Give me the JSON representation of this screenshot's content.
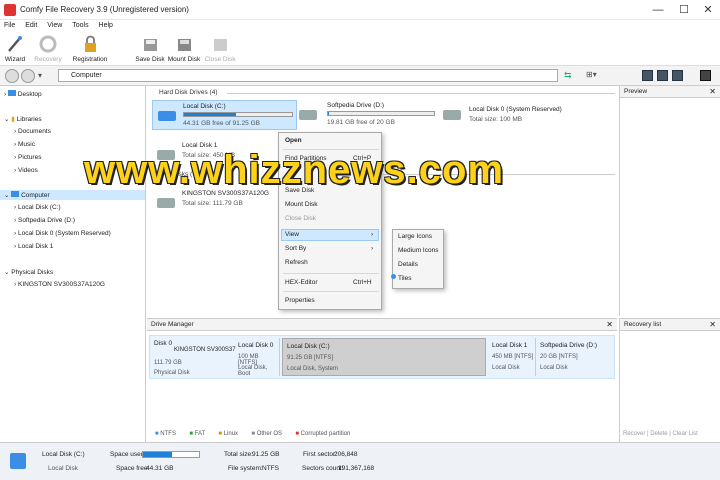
{
  "window": {
    "title": "Comfy File Recovery 3.9 (Unregistered version)",
    "min": "—",
    "max": "☐",
    "close": "✕"
  },
  "menu": [
    "File",
    "Edit",
    "View",
    "Tools",
    "Help"
  ],
  "toolbar": [
    "Wizard",
    "Recovery",
    "Registration",
    "Save Disk",
    "Mount Disk",
    "Close Disk"
  ],
  "address": {
    "path": "Computer"
  },
  "tree": {
    "desktop": "Desktop",
    "libraries": "Libraries",
    "documents": "Documents",
    "music": "Music",
    "pictures": "Pictures",
    "videos": "Videos",
    "computer": "Computer",
    "c": "Local Disk (C:)",
    "d": "Softpedia Drive (D:)",
    "disk0": "Local Disk 0 (System Reserved)",
    "disk1": "Local Disk 1",
    "physical": "Physical Disks",
    "kingston": "KINGSTON SV300S37A120G"
  },
  "main": {
    "hdd_header": "Hard Disk Drives (4)",
    "disks": [
      {
        "name": "Local Disk (C:)",
        "info": "44.31 GB free of 91.25 GB",
        "fill": 0.48
      },
      {
        "name": "Softpedia Drive (D:)",
        "info": "19.81 GB free of 20 GB",
        "fill": 0.01
      },
      {
        "name": "Local Disk 0 (System Reserved)",
        "info": "Total size: 100 MB"
      },
      {
        "name": "Local Disk 1",
        "info": "Total size: 450 MB"
      }
    ],
    "phys_header": "isks (",
    "phys": {
      "name": "KINGSTON SV300S37A120G",
      "info": "Total size: 111.79 GB"
    },
    "preview": "Preview"
  },
  "context_menu": [
    "Open",
    "Find Partitions",
    "Ctrl+P",
    "Save Disk",
    "Mount Disk",
    "Close Disk",
    "View",
    "Sort By",
    "Refresh",
    "HEX-Editor",
    "Ctrl+H",
    "Properties"
  ],
  "submenu": [
    "Large Icons",
    "Medium Icons",
    "Details",
    "Tiles"
  ],
  "watermark": "www.whizznews.com",
  "drive_manager": {
    "title": "Drive Manager",
    "disk0": {
      "name": "Disk 0",
      "model": "KINGSTON SV300S37",
      "size": "111.79 GB",
      "type": "Physical Disk"
    },
    "parts": [
      {
        "name": "Local Disk 0",
        "size": "100 MB [NTFS]",
        "desc": "Local Disk, Boot"
      },
      {
        "name": "Local Disk (C:)",
        "size": "91.25 GB [NTFS]",
        "desc": "Local Disk, System"
      },
      {
        "name": "Local Disk 1",
        "size": "450 MB [NTFS]",
        "desc": "Local Disk"
      },
      {
        "name": "Softpedia Drive (D:)",
        "size": "20 GB [NTFS]",
        "desc": "Local Disk"
      }
    ],
    "legend": [
      "NTFS",
      "FAT",
      "Linux",
      "Other OS",
      "Corrupted partition"
    ]
  },
  "recovery_list": {
    "title": "Recovery list",
    "recover": "Recover",
    "delete": "Delete",
    "clear": "Clear List"
  },
  "status": {
    "name": "Local Disk (C:)",
    "type": "Local Disk",
    "used_label": "Space used:",
    "free_label": "Space free:",
    "free": "44.31 GB",
    "total_label": "Total size:",
    "total": "91.25 GB",
    "fs_label": "File system:",
    "fs": "NTFS",
    "first_label": "First sector:",
    "first": "206,848",
    "count_label": "Sectors count:",
    "count": "191,367,168",
    "used_fill": 0.51
  },
  "colors": {
    "accent": "#1e7fd6",
    "selected": "#cde8ff",
    "watermark": "#ffd21a"
  }
}
